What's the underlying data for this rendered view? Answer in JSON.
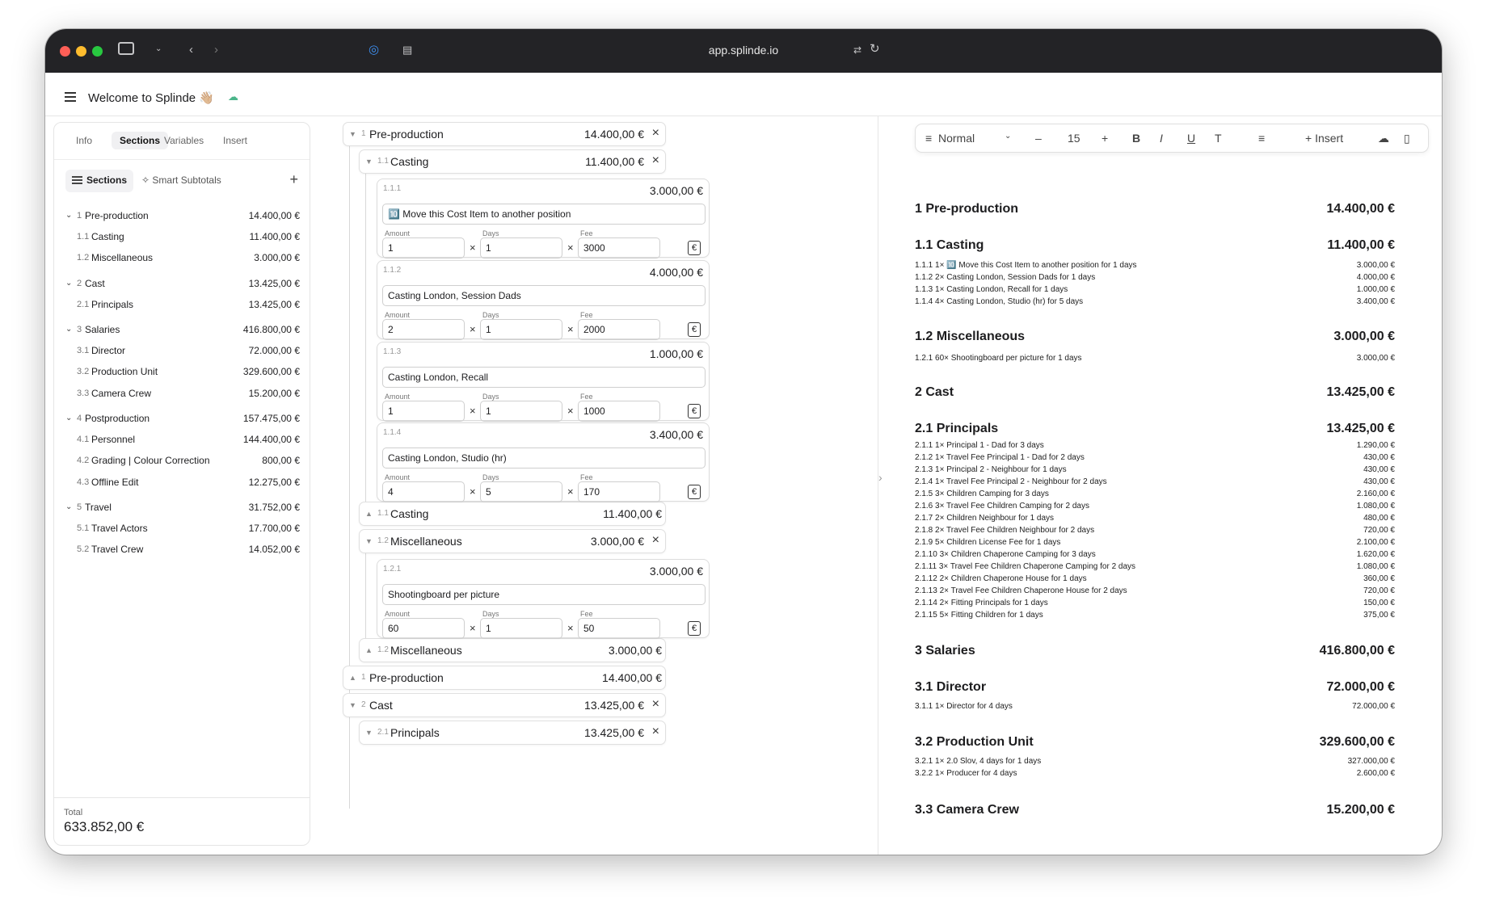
{
  "browser": {
    "url": "app.splinde.io"
  },
  "app": {
    "title": "Welcome to Splinde 👋🏼"
  },
  "left": {
    "tabs": [
      "Info",
      "Sections",
      "Variables",
      "Insert"
    ],
    "sections_btn": "Sections",
    "smart_btn": "Smart Subtotals",
    "add": "+",
    "tree": [
      {
        "n": "1",
        "label": "Pre-production",
        "value": "14.400,00 €",
        "top": true
      },
      {
        "n": "1.1",
        "label": "Casting",
        "value": "11.400,00 €"
      },
      {
        "n": "1.2",
        "label": "Miscellaneous",
        "value": "3.000,00 €"
      },
      {
        "n": "2",
        "label": "Cast",
        "value": "13.425,00 €",
        "top": true
      },
      {
        "n": "2.1",
        "label": "Principals",
        "value": "13.425,00 €"
      },
      {
        "n": "3",
        "label": "Salaries",
        "value": "416.800,00 €",
        "top": true
      },
      {
        "n": "3.1",
        "label": "Director",
        "value": "72.000,00 €"
      },
      {
        "n": "3.2",
        "label": "Production Unit",
        "value": "329.600,00 €"
      },
      {
        "n": "3.3",
        "label": "Camera Crew",
        "value": "15.200,00 €"
      },
      {
        "n": "4",
        "label": "Postproduction",
        "value": "157.475,00 €",
        "top": true
      },
      {
        "n": "4.1",
        "label": "Personnel",
        "value": "144.400,00 €"
      },
      {
        "n": "4.2",
        "label": "Grading | Colour Correction",
        "value": "800,00 €"
      },
      {
        "n": "4.3",
        "label": "Offline Edit",
        "value": "12.275,00 €"
      },
      {
        "n": "5",
        "label": "Travel",
        "value": "31.752,00 €",
        "top": true
      },
      {
        "n": "5.1",
        "label": "Travel Actors",
        "value": "17.700,00 €"
      },
      {
        "n": "5.2",
        "label": "Travel Crew",
        "value": "14.052,00 €"
      }
    ],
    "total_label": "Total",
    "total_value": "633.852,00 €"
  },
  "mid": {
    "bars": [
      {
        "n": "1",
        "label": "Pre-production",
        "value": "14.400,00 €",
        "x": true
      },
      {
        "n": "1.1",
        "label": "Casting",
        "value": "11.400,00 €",
        "x": true
      },
      {
        "n": "1.1",
        "label": "Casting",
        "value": "11.400,00 €"
      },
      {
        "n": "1.2",
        "label": "Miscellaneous",
        "value": "3.000,00 €",
        "x": true
      },
      {
        "n": "1.2",
        "label": "Miscellaneous",
        "value": "3.000,00 €"
      },
      {
        "n": "1",
        "label": "Pre-production",
        "value": "14.400,00 €"
      },
      {
        "n": "2",
        "label": "Cast",
        "value": "13.425,00 €",
        "x": true
      },
      {
        "n": "2.1",
        "label": "Principals",
        "value": "13.425,00 €",
        "x": true
      }
    ],
    "cards": [
      {
        "n": "1.1.1",
        "total": "3.000,00 €",
        "desc": "🔟 Move this Cost Item to another position",
        "amount": "1",
        "days": "1",
        "fee": "3000"
      },
      {
        "n": "1.1.2",
        "total": "4.000,00 €",
        "desc": "Casting London, Session Dads",
        "amount": "2",
        "days": "1",
        "fee": "2000"
      },
      {
        "n": "1.1.3",
        "total": "1.000,00 €",
        "desc": "Casting London, Recall",
        "amount": "1",
        "days": "1",
        "fee": "1000"
      },
      {
        "n": "1.1.4",
        "total": "3.400,00 €",
        "desc": "Casting London, Studio (hr)",
        "amount": "4",
        "days": "5",
        "fee": "170"
      },
      {
        "n": "1.2.1",
        "total": "3.000,00 €",
        "desc": "Shootingboard per picture",
        "amount": "60",
        "days": "1",
        "fee": "50"
      }
    ],
    "labels": {
      "amount": "Amount",
      "days": "Days",
      "fee": "Fee",
      "times": "×",
      "currency": "€"
    }
  },
  "toolbar": {
    "style": "Normal",
    "minus": "–",
    "size": "15",
    "plus": "+",
    "bold": "B",
    "italic": "I",
    "underline": "U",
    "text": "T",
    "insert": "Insert"
  },
  "doc": [
    {
      "t": "h",
      "a": "1 Pre-production",
      "b": "14.400,00 €"
    },
    {
      "t": "h",
      "a": "1.1 Casting",
      "b": "11.400,00 €"
    },
    {
      "t": "l",
      "a": "1.1.1 1× 🔟 Move this Cost Item to another position for 1 days",
      "b": "3.000,00 €"
    },
    {
      "t": "l",
      "a": "1.1.2 2× Casting London, Session Dads for 1 days",
      "b": "4.000,00 €"
    },
    {
      "t": "l",
      "a": "1.1.3 1× Casting London, Recall for 1 days",
      "b": "1.000,00 €"
    },
    {
      "t": "l",
      "a": "1.1.4 4× Casting London, Studio (hr) for 5 days",
      "b": "3.400,00 €"
    },
    {
      "t": "h",
      "a": "1.2 Miscellaneous",
      "b": "3.000,00 €"
    },
    {
      "t": "l",
      "a": "1.2.1 60× Shootingboard per picture for 1 days",
      "b": "3.000,00 €"
    },
    {
      "t": "h",
      "a": "2 Cast",
      "b": "13.425,00 €"
    },
    {
      "t": "h",
      "a": "2.1 Principals",
      "b": "13.425,00 €"
    },
    {
      "t": "l",
      "a": "2.1.1 1× Principal 1 - Dad for 3 days",
      "b": "1.290,00 €"
    },
    {
      "t": "l",
      "a": "2.1.2 1× Travel Fee Principal 1 - Dad for 2 days",
      "b": "430,00 €"
    },
    {
      "t": "l",
      "a": "2.1.3 1× Principal 2 - Neighbour for 1 days",
      "b": "430,00 €"
    },
    {
      "t": "l",
      "a": "2.1.4 1× Travel Fee Principal 2 - Neighbour for 2 days",
      "b": "430,00 €"
    },
    {
      "t": "l",
      "a": "2.1.5 3× Children Camping for 3 days",
      "b": "2.160,00 €"
    },
    {
      "t": "l",
      "a": "2.1.6 3× Travel Fee Children Camping for 2 days",
      "b": "1.080,00 €"
    },
    {
      "t": "l",
      "a": "2.1.7 2× Children Neighbour for 1 days",
      "b": "480,00 €"
    },
    {
      "t": "l",
      "a": "2.1.8 2× Travel Fee Children Neighbour for 2 days",
      "b": "720,00 €"
    },
    {
      "t": "l",
      "a": "2.1.9 5× Children License Fee for 1 days",
      "b": "2.100,00 €"
    },
    {
      "t": "l",
      "a": "2.1.10 3× Children Chaperone Camping for 3 days",
      "b": "1.620,00 €"
    },
    {
      "t": "l",
      "a": "2.1.11 3× Travel Fee Children Chaperone Camping for 2 days",
      "b": "1.080,00 €"
    },
    {
      "t": "l",
      "a": "2.1.12 2× Children Chaperone House for 1 days",
      "b": "360,00 €"
    },
    {
      "t": "l",
      "a": "2.1.13 2× Travel Fee Children Chaperone House for 2 days",
      "b": "720,00 €"
    },
    {
      "t": "l",
      "a": "2.1.14 2× Fitting Principals for 1 days",
      "b": "150,00 €"
    },
    {
      "t": "l",
      "a": "2.1.15 5× Fitting Children for 1 days",
      "b": "375,00 €"
    },
    {
      "t": "h",
      "a": "3 Salaries",
      "b": "416.800,00 €"
    },
    {
      "t": "h",
      "a": "3.1 Director",
      "b": "72.000,00 €"
    },
    {
      "t": "l",
      "a": "3.1.1 1× Director for 4 days",
      "b": "72.000,00 €"
    },
    {
      "t": "h",
      "a": "3.2 Production Unit",
      "b": "329.600,00 €"
    },
    {
      "t": "l",
      "a": "3.2.1 1× 2.0 Slov, 4 days for 1 days",
      "b": "327.000,00 €"
    },
    {
      "t": "l",
      "a": "3.2.2 1× Producer for 4 days",
      "b": "2.600,00 €"
    },
    {
      "t": "h",
      "a": "3.3 Camera Crew",
      "b": "15.200,00 €"
    }
  ]
}
